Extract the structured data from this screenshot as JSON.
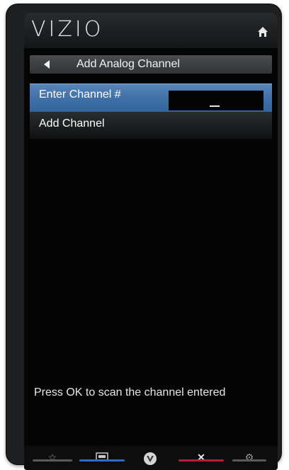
{
  "header": {
    "brand": "VIZIO"
  },
  "menu": {
    "title": "Add Analog Channel",
    "items": [
      {
        "label": "Enter Channel #",
        "value": ""
      },
      {
        "label": "Add Channel"
      }
    ]
  },
  "hint": "Press OK to scan the channel entered",
  "bottom_bar": {
    "buttons": [
      {
        "icon": "star-icon",
        "accent": "#6b6b6b"
      },
      {
        "icon": "input-icon",
        "accent": "#2f6fba"
      },
      {
        "icon": "vizio-v-icon",
        "accent": "#6b6b6b"
      },
      {
        "icon": "close-icon",
        "accent": "#b0203a"
      },
      {
        "icon": "gear-icon",
        "accent": "#6b6b6b"
      }
    ]
  },
  "colors": {
    "selection": "#3d6ea6",
    "exit_accent": "#b0203a",
    "input_accent": "#2f6fba"
  }
}
